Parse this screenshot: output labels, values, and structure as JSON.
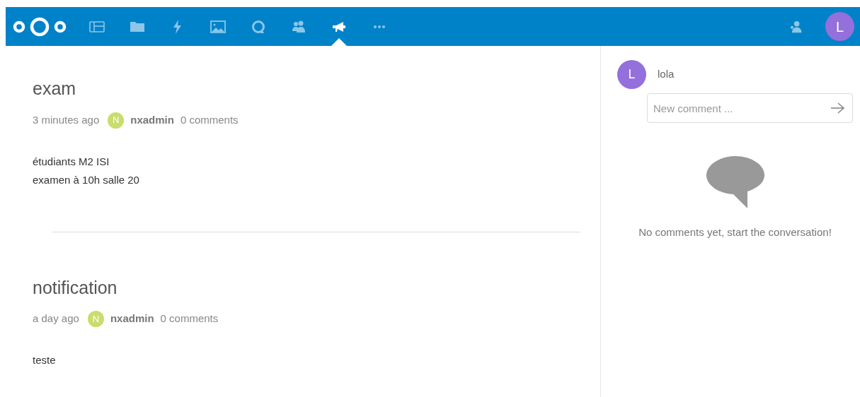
{
  "header": {
    "apps": [
      {
        "kind": "dashboard",
        "selected": false
      },
      {
        "kind": "files",
        "selected": false
      },
      {
        "kind": "activity",
        "selected": false
      },
      {
        "kind": "gallery",
        "selected": false
      },
      {
        "kind": "search",
        "selected": false
      },
      {
        "kind": "contacts",
        "selected": false
      },
      {
        "kind": "announcements",
        "selected": true
      },
      {
        "kind": "more",
        "selected": false
      }
    ],
    "user": {
      "initial": "L",
      "color": "#9370db"
    }
  },
  "posts": [
    {
      "title": "exam",
      "time": "3 minutes ago",
      "author": {
        "initial": "N",
        "name": "nxadmin",
        "color": "#c9dd6b"
      },
      "comments": "0 comments",
      "lines": [
        "étudiants M2 ISI",
        "examen à 10h salle 20"
      ]
    },
    {
      "title": "notification",
      "time": "a day ago",
      "author": {
        "initial": "N",
        "name": "nxadmin",
        "color": "#c9dd6b"
      },
      "comments": "0 comments",
      "lines": [
        "teste"
      ]
    }
  ],
  "sidebar": {
    "user": {
      "initial": "L",
      "name": "lola",
      "color": "#9370db"
    },
    "comment_field": {
      "placeholder": "New comment ..."
    },
    "empty_message": "No comments yet, start the conversation!"
  }
}
